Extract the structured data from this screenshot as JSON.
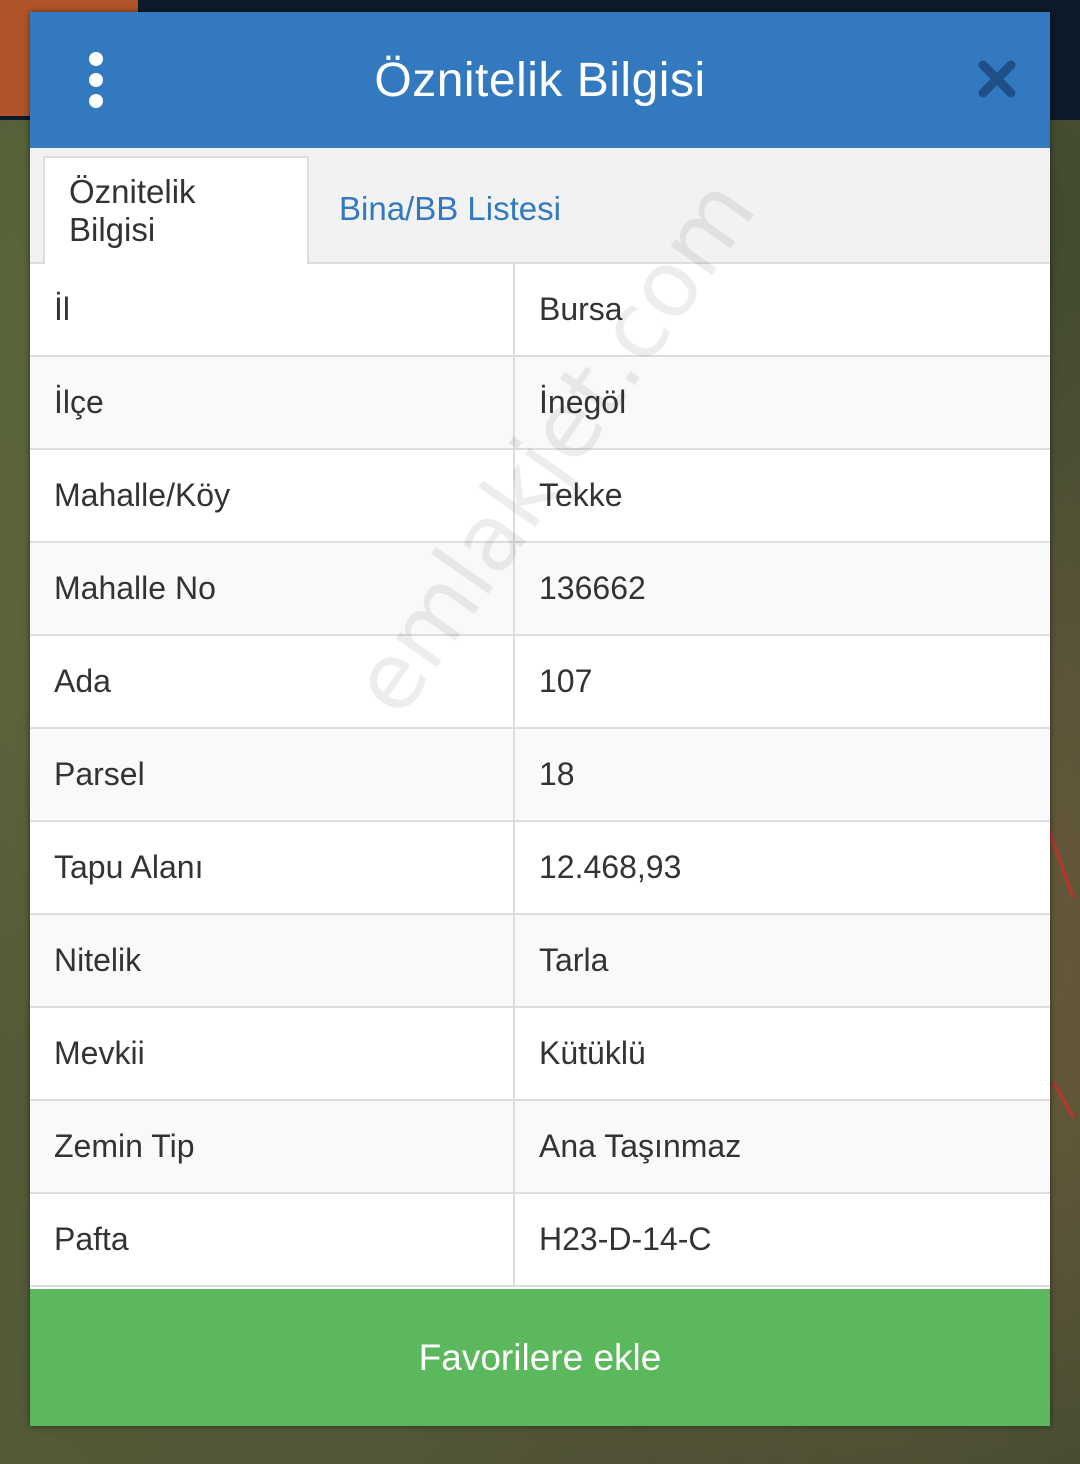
{
  "dialog": {
    "title": "Öznitelik Bilgisi",
    "menu_icon": "vertical-dots-icon",
    "close_icon": "close-icon"
  },
  "tabs": [
    {
      "label": "Öznitelik Bilgisi",
      "active": true
    },
    {
      "label": "Bina/BB Listesi",
      "active": false
    }
  ],
  "attributes": [
    {
      "key": "İl",
      "value": "Bursa"
    },
    {
      "key": "İlçe",
      "value": "İnegöl"
    },
    {
      "key": "Mahalle/Köy",
      "value": "Tekke"
    },
    {
      "key": "Mahalle No",
      "value": "136662"
    },
    {
      "key": "Ada",
      "value": "107"
    },
    {
      "key": "Parsel",
      "value": "18"
    },
    {
      "key": "Tapu Alanı",
      "value": "12.468,93"
    },
    {
      "key": "Nitelik",
      "value": "Tarla"
    },
    {
      "key": "Mevkii",
      "value": "Kütüklü"
    },
    {
      "key": "Zemin Tip",
      "value": "Ana Taşınmaz"
    },
    {
      "key": "Pafta",
      "value": "H23-D-14-C"
    }
  ],
  "footer": {
    "favorite_label": "Favorilere ekle"
  },
  "watermark": "emlakjet.com",
  "colors": {
    "header": "#3379c0",
    "tab_link": "#3379c0",
    "favorite_button": "#5cb85c"
  }
}
